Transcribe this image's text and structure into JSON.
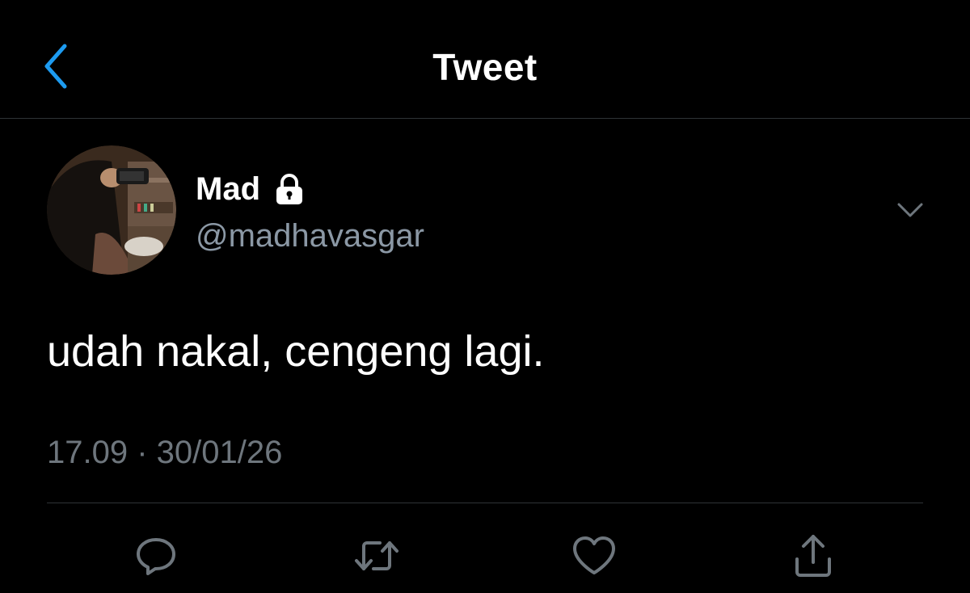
{
  "header": {
    "title": "Tweet",
    "back_icon": "chevron-left-icon",
    "accent_color": "#1d9bf0"
  },
  "tweet": {
    "author": {
      "display_name": "Mad",
      "handle": "@madhavasgar",
      "protected_icon": "lock-icon",
      "avatar": "profile-photo"
    },
    "more_icon": "chevron-down-icon",
    "text": "udah nakal, cengeng lagi.",
    "timestamp": "17.09 · 30/01/26"
  },
  "actions": [
    {
      "name": "reply",
      "icon": "comment-icon"
    },
    {
      "name": "retweet",
      "icon": "retweet-icon"
    },
    {
      "name": "like",
      "icon": "heart-icon"
    },
    {
      "name": "share",
      "icon": "share-icon"
    }
  ],
  "colors": {
    "background": "#000000",
    "primary_text": "#ffffff",
    "secondary_text": "#8b98a5",
    "timestamp_text": "#6e767d",
    "divider": "#2f3336",
    "icon": "#6e767d"
  }
}
